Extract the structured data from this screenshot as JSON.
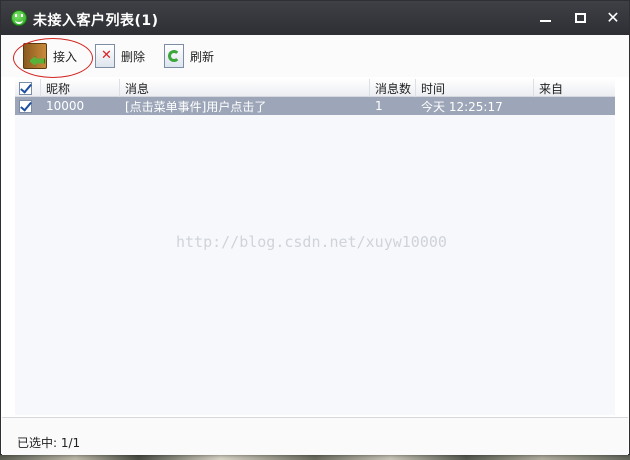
{
  "window": {
    "title": "未接入客户列表(1)",
    "close_glyph": "✕"
  },
  "toolbar": {
    "accept_label": "接入",
    "delete_label": "删除",
    "refresh_label": "刷新",
    "delete_mark": "✕"
  },
  "table": {
    "columns": [
      "昵称",
      "消息",
      "消息数",
      "时间",
      "来自"
    ],
    "rows": [
      {
        "checked": true,
        "nickname": "10000",
        "message": "[点击菜单事件]用户点击了",
        "count": "1",
        "time": "今天 12:25:17",
        "from": ""
      }
    ]
  },
  "watermark": "http://blog.csdn.net/xuyw10000",
  "status": {
    "text": "已选中: 1/1"
  },
  "icons": {
    "app": "smiley-app-icon",
    "accept": "door-enter-icon",
    "delete": "document-delete-icon",
    "refresh": "document-refresh-icon",
    "checkbox": "checkbox-checked-icon"
  },
  "colors": {
    "titlebar": "#2e2f34",
    "selected_row": "#9ca6b8",
    "highlight": "#d2241e"
  }
}
